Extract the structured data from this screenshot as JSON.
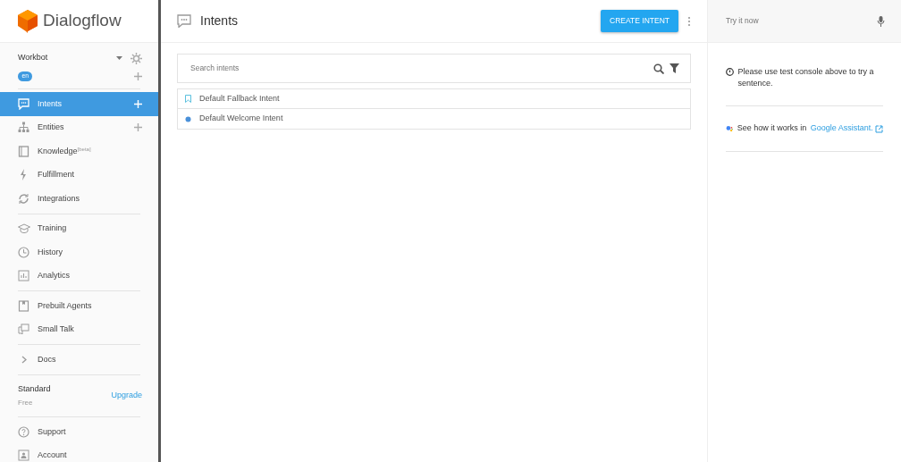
{
  "brand": "Dialogflow",
  "agent": {
    "name": "Workbot",
    "language": "en"
  },
  "nav_groups": [
    {
      "items": [
        {
          "label": "Intents",
          "selected": true,
          "addable": true
        },
        {
          "label": "Entities",
          "selected": false,
          "addable": true
        },
        {
          "label": "Knowledge$^{[beta]}$",
          "selected": false,
          "addable": false
        },
        {
          "label": "Fulfillment",
          "selected": false,
          "addable": false
        },
        {
          "label": "Integrations",
          "selected": false,
          "addable": false
        }
      ]
    },
    {
      "items": [
        {
          "label": "Training",
          "selected": false,
          "addable": false
        },
        {
          "label": "History",
          "selected": false,
          "addable": false
        },
        {
          "label": "Analytics",
          "selected": false,
          "addable": false
        }
      ]
    },
    {
      "items": [
        {
          "label": "Prebuilt Agents",
          "selected": false,
          "addable": false
        },
        {
          "label": "Small Talk",
          "selected": false,
          "addable": false
        }
      ]
    },
    {
      "items": [
        {
          "label": "Docs",
          "selected": false,
          "addable": false
        }
      ]
    }
  ],
  "plan": {
    "name": "Standard",
    "price": "Free",
    "action": "Upgrade"
  },
  "footer_items": [
    {
      "label": "Support"
    },
    {
      "label": "Account"
    }
  ],
  "page_title": "Intents",
  "create_button": "CREATE INTENT",
  "search": {
    "placeholder": "Search intents"
  },
  "intents": [
    {
      "name": "Default Fallback Intent",
      "kind": "fallback"
    },
    {
      "name": "Default Welcome Intent",
      "kind": "welcome"
    }
  ],
  "console": {
    "placeholder": "Try it now",
    "hint": "Please use test console above to try a sentence.",
    "assistant_text": "See how it works in",
    "assistant_link": "Google Assistant."
  }
}
